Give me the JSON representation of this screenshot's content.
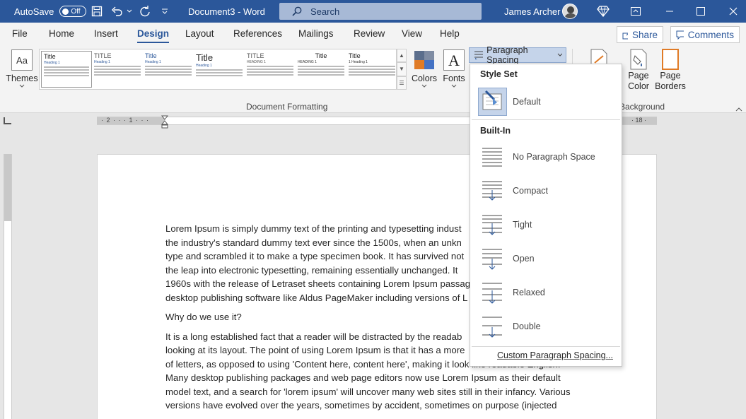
{
  "titlebar": {
    "autosave_label": "AutoSave",
    "autosave_state": "Off",
    "doc_title": "Document3  -  Word",
    "search_placeholder": "Search",
    "user_name": "James Archer",
    "bg_color": "#2b579a"
  },
  "tabs": [
    {
      "label": "File"
    },
    {
      "label": "Home"
    },
    {
      "label": "Insert"
    },
    {
      "label": "Design",
      "active": true
    },
    {
      "label": "Layout"
    },
    {
      "label": "References"
    },
    {
      "label": "Mailings"
    },
    {
      "label": "Review"
    },
    {
      "label": "View"
    },
    {
      "label": "Help"
    }
  ],
  "actions": {
    "share_label": "Share",
    "comments_label": "Comments"
  },
  "ribbon": {
    "themes_label": "Themes",
    "themes_icon_text": "Aa",
    "gallery": [
      {
        "title": "Title",
        "heading": "Heading 1"
      },
      {
        "title": "TITLE",
        "heading": "Heading 1"
      },
      {
        "title": "Title",
        "heading": "Heading 1"
      },
      {
        "title": "Title",
        "heading": "Heading 1"
      },
      {
        "title": "TITLE",
        "heading": "HEADING 1"
      },
      {
        "title": "Title",
        "heading": "HEADING 1"
      },
      {
        "title": "Title",
        "heading": "1  Heading 1"
      }
    ],
    "colors_label": "Colors",
    "fonts_label": "Fonts",
    "fonts_icon_text": "A",
    "paragraph_spacing_label": "Paragraph Spacing",
    "page_color_label": "Page Color",
    "page_borders_label": "Page Borders",
    "group_document_formatting": "Document Formatting",
    "group_background": "Background"
  },
  "ruler": {
    "numbers_left": "· 2 · · · 1 · · · ",
    "marker_right": "· 18 ·"
  },
  "document": {
    "paragraphs": [
      [
        "Lorem Ipsum is simply dummy text of the printing and typesetting indust",
        "the industry's standard dummy text ever since the 1500s, when an unkn",
        "type and scrambled it to make a type specimen book. It has survived not",
        "the leap into electronic typesetting, remaining essentially unchanged. It",
        "1960s with the release of Letraset sheets containing Lorem Ipsum passag",
        "desktop publishing software like Aldus PageMaker including versions of L"
      ],
      [
        "Why do we use it?"
      ],
      [
        "It is a long established fact that a reader will be distracted by the readab",
        "looking at its layout. The point of using Lorem Ipsum is that it has a more",
        "of letters, as opposed to using 'Content here, content here', making it look like readable English.",
        "Many desktop publishing packages and web page editors now use Lorem Ipsum as their default",
        "model text, and a search for 'lorem ipsum' will uncover many web sites still in their infancy. Various",
        "versions have evolved over the years, sometimes by accident, sometimes on purpose (injected"
      ]
    ]
  },
  "menu": {
    "style_set_header": "Style Set",
    "default_label": "Default",
    "builtin_header": "Built-In",
    "items": [
      {
        "label": "No Paragraph Space",
        "icon": "no-paragraph-space-icon"
      },
      {
        "label": "Compact",
        "icon": "compact-spacing-icon"
      },
      {
        "label": "Tight",
        "icon": "tight-spacing-icon"
      },
      {
        "label": "Open",
        "icon": "open-spacing-icon"
      },
      {
        "label": "Relaxed",
        "icon": "relaxed-spacing-icon"
      },
      {
        "label": "Double",
        "icon": "double-spacing-icon"
      }
    ],
    "custom_label": "Custom Paragraph Spacing..."
  }
}
